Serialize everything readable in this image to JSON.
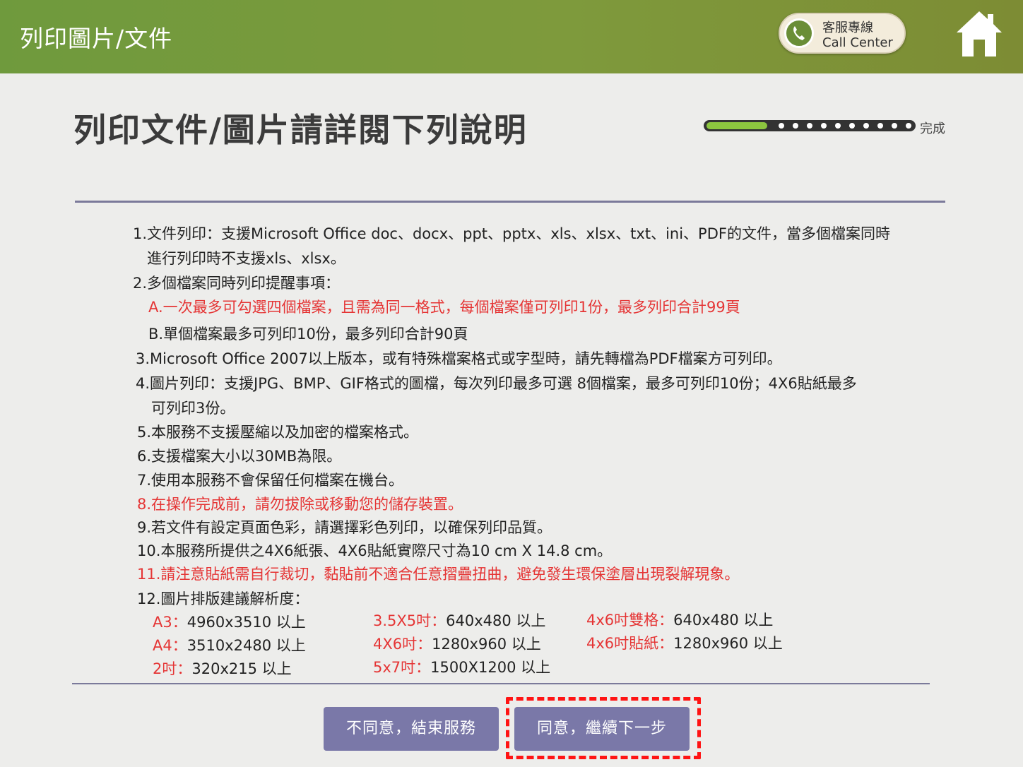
{
  "header": {
    "title": "列印圖片/文件",
    "call_center_line1": "客服專線",
    "call_center_line2": "Call Center",
    "brand_color": "#7e9a3c"
  },
  "main": {
    "heading": "列印文件/圖片請詳閱下列說明",
    "progress": {
      "label": "完成",
      "steps_total": 11,
      "steps_done": 1,
      "fill_color": "#8cc63f"
    }
  },
  "instructions": {
    "l1a": "1.文件列印：支援Microsoft Office doc、docx、ppt、pptx、xls、xlsx、txt、ini、PDF的文件，當多個檔案同時",
    "l1b": "進行列印時不支援xls、xlsx。",
    "l2": "2.多個檔案同時列印提醒事項：",
    "l2a": "A.一次最多可勾選四個檔案，且需為同一格式，每個檔案僅可列印1份，最多列印合計99頁",
    "l2b": "B.單個檔案最多可列印10份，最多列印合計90頁",
    "l3": "3.Microsoft Office 2007以上版本，或有特殊檔案格式或字型時，請先轉檔為PDF檔案方可列印。",
    "l4a": "4.圖片列印：支援JPG、BMP、GIF格式的圖檔，每次列印最多可選 8個檔案，最多可列印10份；4X6貼紙最多",
    "l4b": "可列印3份。",
    "l5": "5.本服務不支援壓縮以及加密的檔案格式。",
    "l6": "6.支援檔案大小以30MB為限。",
    "l7": "7.使用本服務不會保留任何檔案在機台。",
    "l8": "8.在操作完成前，請勿拔除或移動您的儲存裝置。",
    "l9": "9.若文件有設定頁面色彩，請選擇彩色列印，以確保列印品質。",
    "l10": "10.本服務所提供之4X6紙張、4X6貼紙實際尺寸為10 cm X 14.8 cm。",
    "l11": "11.請注意貼紙需自行裁切，黏貼前不適合任意摺疊扭曲，避免發生環保塗層出現裂解現象。",
    "l12": "12.圖片排版建議解析度："
  },
  "resolutions": [
    {
      "label": "A3：",
      "value": "4960x3510 以上"
    },
    {
      "label": "A4：",
      "value": "3510x2480 以上"
    },
    {
      "label": "2吋：",
      "value": "320x215 以上"
    },
    {
      "label": "3.5X5吋：",
      "value": "640x480 以上"
    },
    {
      "label": "4X6吋：",
      "value": "1280x960 以上"
    },
    {
      "label": "5x7吋：",
      "value": "1500X1200 以上"
    },
    {
      "label": "4x6吋雙格：",
      "value": "640x480 以上"
    },
    {
      "label": "4x6吋貼紙：",
      "value": "1280x960 以上"
    }
  ],
  "buttons": {
    "disagree": "不同意，結束服務",
    "agree": "同意，繼續下一步"
  }
}
